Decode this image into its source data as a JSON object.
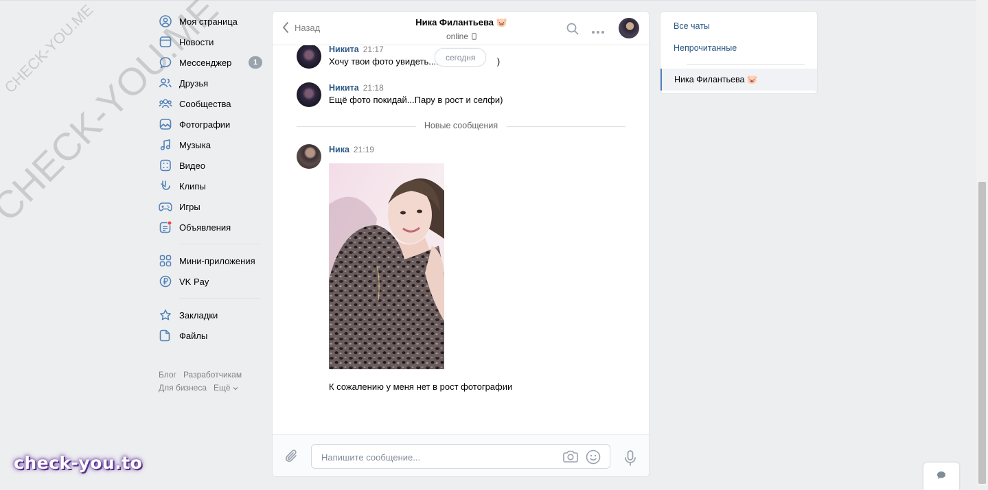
{
  "nav": {
    "items": [
      {
        "label": "Моя страница",
        "icon": "user-circle-icon"
      },
      {
        "label": "Новости",
        "icon": "news-icon"
      },
      {
        "label": "Мессенджер",
        "icon": "message-icon",
        "badge": "1"
      },
      {
        "label": "Друзья",
        "icon": "friends-icon"
      },
      {
        "label": "Сообщества",
        "icon": "communities-icon"
      },
      {
        "label": "Фотографии",
        "icon": "photos-icon"
      },
      {
        "label": "Музыка",
        "icon": "music-icon"
      },
      {
        "label": "Видео",
        "icon": "video-icon"
      },
      {
        "label": "Клипы",
        "icon": "clips-icon"
      },
      {
        "label": "Игры",
        "icon": "gamepad-icon"
      },
      {
        "label": "Объявления",
        "icon": "ads-icon"
      }
    ],
    "items2": [
      {
        "label": "Мини-приложения",
        "icon": "apps-icon"
      },
      {
        "label": "VK Pay",
        "icon": "vkpay-icon"
      }
    ],
    "items3": [
      {
        "label": "Закладки",
        "icon": "star-icon"
      },
      {
        "label": "Файлы",
        "icon": "file-icon"
      }
    ],
    "footer": {
      "blog": "Блог",
      "dev": "Разработчикам",
      "business": "Для бизнеса",
      "more": "Ещё"
    }
  },
  "chat": {
    "back_label": "Назад",
    "peer_name": "Ника Филантьева 🐷",
    "peer_status": "online",
    "date_pill": "сегодня",
    "new_messages_label": "Новые сообщения",
    "messages": [
      {
        "author": "Никита",
        "time": "21:17",
        "text": "Хочу твои фото увидеть......",
        "text_tail": ")"
      },
      {
        "author": "Никита",
        "time": "21:18",
        "text": "Ещё фото покидай...Пару в рост и селфи)"
      },
      {
        "author": "Ника",
        "time": "21:19",
        "caption": "К сожалению у меня нет в рост фотографии"
      }
    ],
    "composer_placeholder": "Напишите сообщение..."
  },
  "right": {
    "all_chats": "Все чаты",
    "unread": "Непрочитанные",
    "active_chat": "Ника Филантьева 🐷"
  },
  "watermark": {
    "diag_large": "CHECK-YOU.ME",
    "diag_small": "CHECK-YOU.ME",
    "brand": "check-you.to"
  },
  "colors": {
    "link": "#2a5885",
    "accent": "#5181b8",
    "icon": "#5181b8",
    "badge": "#99a2ad"
  }
}
